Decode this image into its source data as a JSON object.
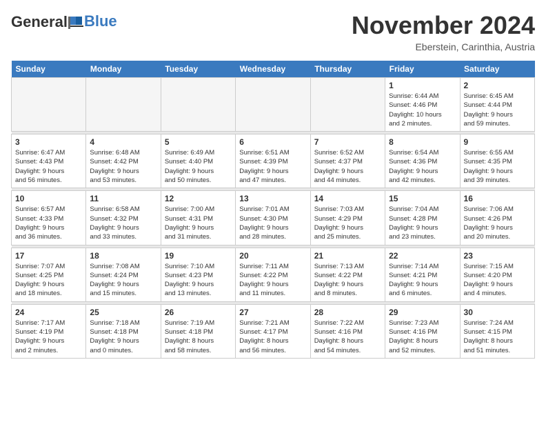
{
  "header": {
    "logo_line1": "General",
    "logo_line2": "Blue",
    "title": "November 2024",
    "subtitle": "Eberstein, Carinthia, Austria"
  },
  "weekdays": [
    "Sunday",
    "Monday",
    "Tuesday",
    "Wednesday",
    "Thursday",
    "Friday",
    "Saturday"
  ],
  "weeks": [
    [
      {
        "day": "",
        "info": ""
      },
      {
        "day": "",
        "info": ""
      },
      {
        "day": "",
        "info": ""
      },
      {
        "day": "",
        "info": ""
      },
      {
        "day": "",
        "info": ""
      },
      {
        "day": "1",
        "info": "Sunrise: 6:44 AM\nSunset: 4:46 PM\nDaylight: 10 hours\nand 2 minutes."
      },
      {
        "day": "2",
        "info": "Sunrise: 6:45 AM\nSunset: 4:44 PM\nDaylight: 9 hours\nand 59 minutes."
      }
    ],
    [
      {
        "day": "3",
        "info": "Sunrise: 6:47 AM\nSunset: 4:43 PM\nDaylight: 9 hours\nand 56 minutes."
      },
      {
        "day": "4",
        "info": "Sunrise: 6:48 AM\nSunset: 4:42 PM\nDaylight: 9 hours\nand 53 minutes."
      },
      {
        "day": "5",
        "info": "Sunrise: 6:49 AM\nSunset: 4:40 PM\nDaylight: 9 hours\nand 50 minutes."
      },
      {
        "day": "6",
        "info": "Sunrise: 6:51 AM\nSunset: 4:39 PM\nDaylight: 9 hours\nand 47 minutes."
      },
      {
        "day": "7",
        "info": "Sunrise: 6:52 AM\nSunset: 4:37 PM\nDaylight: 9 hours\nand 44 minutes."
      },
      {
        "day": "8",
        "info": "Sunrise: 6:54 AM\nSunset: 4:36 PM\nDaylight: 9 hours\nand 42 minutes."
      },
      {
        "day": "9",
        "info": "Sunrise: 6:55 AM\nSunset: 4:35 PM\nDaylight: 9 hours\nand 39 minutes."
      }
    ],
    [
      {
        "day": "10",
        "info": "Sunrise: 6:57 AM\nSunset: 4:33 PM\nDaylight: 9 hours\nand 36 minutes."
      },
      {
        "day": "11",
        "info": "Sunrise: 6:58 AM\nSunset: 4:32 PM\nDaylight: 9 hours\nand 33 minutes."
      },
      {
        "day": "12",
        "info": "Sunrise: 7:00 AM\nSunset: 4:31 PM\nDaylight: 9 hours\nand 31 minutes."
      },
      {
        "day": "13",
        "info": "Sunrise: 7:01 AM\nSunset: 4:30 PM\nDaylight: 9 hours\nand 28 minutes."
      },
      {
        "day": "14",
        "info": "Sunrise: 7:03 AM\nSunset: 4:29 PM\nDaylight: 9 hours\nand 25 minutes."
      },
      {
        "day": "15",
        "info": "Sunrise: 7:04 AM\nSunset: 4:28 PM\nDaylight: 9 hours\nand 23 minutes."
      },
      {
        "day": "16",
        "info": "Sunrise: 7:06 AM\nSunset: 4:26 PM\nDaylight: 9 hours\nand 20 minutes."
      }
    ],
    [
      {
        "day": "17",
        "info": "Sunrise: 7:07 AM\nSunset: 4:25 PM\nDaylight: 9 hours\nand 18 minutes."
      },
      {
        "day": "18",
        "info": "Sunrise: 7:08 AM\nSunset: 4:24 PM\nDaylight: 9 hours\nand 15 minutes."
      },
      {
        "day": "19",
        "info": "Sunrise: 7:10 AM\nSunset: 4:23 PM\nDaylight: 9 hours\nand 13 minutes."
      },
      {
        "day": "20",
        "info": "Sunrise: 7:11 AM\nSunset: 4:22 PM\nDaylight: 9 hours\nand 11 minutes."
      },
      {
        "day": "21",
        "info": "Sunrise: 7:13 AM\nSunset: 4:22 PM\nDaylight: 9 hours\nand 8 minutes."
      },
      {
        "day": "22",
        "info": "Sunrise: 7:14 AM\nSunset: 4:21 PM\nDaylight: 9 hours\nand 6 minutes."
      },
      {
        "day": "23",
        "info": "Sunrise: 7:15 AM\nSunset: 4:20 PM\nDaylight: 9 hours\nand 4 minutes."
      }
    ],
    [
      {
        "day": "24",
        "info": "Sunrise: 7:17 AM\nSunset: 4:19 PM\nDaylight: 9 hours\nand 2 minutes."
      },
      {
        "day": "25",
        "info": "Sunrise: 7:18 AM\nSunset: 4:18 PM\nDaylight: 9 hours\nand 0 minutes."
      },
      {
        "day": "26",
        "info": "Sunrise: 7:19 AM\nSunset: 4:18 PM\nDaylight: 8 hours\nand 58 minutes."
      },
      {
        "day": "27",
        "info": "Sunrise: 7:21 AM\nSunset: 4:17 PM\nDaylight: 8 hours\nand 56 minutes."
      },
      {
        "day": "28",
        "info": "Sunrise: 7:22 AM\nSunset: 4:16 PM\nDaylight: 8 hours\nand 54 minutes."
      },
      {
        "day": "29",
        "info": "Sunrise: 7:23 AM\nSunset: 4:16 PM\nDaylight: 8 hours\nand 52 minutes."
      },
      {
        "day": "30",
        "info": "Sunrise: 7:24 AM\nSunset: 4:15 PM\nDaylight: 8 hours\nand 51 minutes."
      }
    ]
  ]
}
